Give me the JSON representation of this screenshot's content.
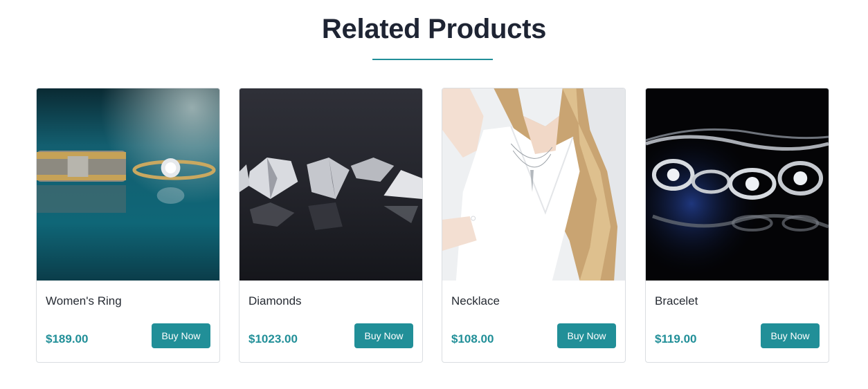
{
  "section": {
    "title": "Related Products",
    "accent_color": "#218f98"
  },
  "products": [
    {
      "name": "Women's Ring",
      "price": "$189.00",
      "button_label": "Buy Now",
      "image": "rings-image"
    },
    {
      "name": "Diamonds",
      "price": "$1023.00",
      "button_label": "Buy Now",
      "image": "diamonds-image"
    },
    {
      "name": "Necklace",
      "price": "$108.00",
      "button_label": "Buy Now",
      "image": "necklace-image"
    },
    {
      "name": "Bracelet",
      "price": "$119.00",
      "button_label": "Buy Now",
      "image": "bracelet-image"
    }
  ]
}
